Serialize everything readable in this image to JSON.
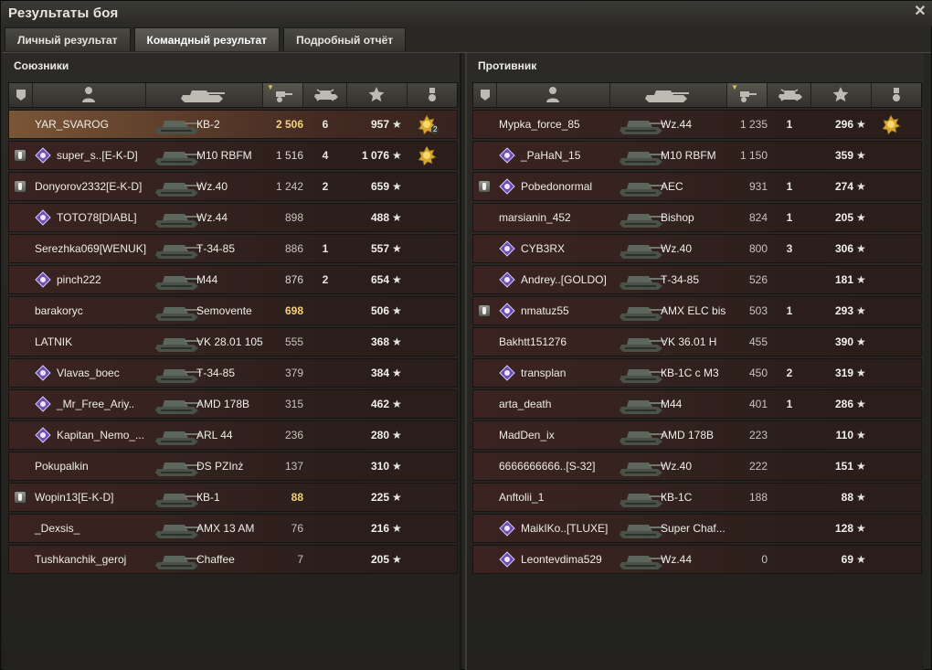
{
  "window": {
    "title": "Результаты боя"
  },
  "tabs": [
    {
      "label": "Личный результат",
      "active": false
    },
    {
      "label": "Командный результат",
      "active": true
    },
    {
      "label": "Подробный отчёт",
      "active": false
    }
  ],
  "colors": {
    "damage_highlight": "#f3d27a",
    "self_row": "#7a5637",
    "row_bg": "#3a2320"
  },
  "teams": [
    {
      "title": "Союзники",
      "rows": [
        {
          "name": "YAR_SVAROG",
          "tank": "КВ-2",
          "damage": "2 506",
          "kills": "6",
          "xp": "957",
          "platoon": false,
          "clan": false,
          "medal": true,
          "medal_count": "2",
          "self": true,
          "dmg_class": "hi"
        },
        {
          "name": "super_s..[E-K-D]",
          "tank": "M10 RBFM",
          "damage": "1 516",
          "kills": "4",
          "xp": "1 076",
          "platoon": true,
          "clan": true,
          "medal": true,
          "medal_count": "",
          "self": false,
          "dmg_class": "mid"
        },
        {
          "name": "Donyorov2332[E-K-D]",
          "tank": "Wz.40",
          "damage": "1 242",
          "kills": "2",
          "xp": "659",
          "platoon": true,
          "clan": false,
          "medal": false,
          "medal_count": "",
          "self": false,
          "dmg_class": ""
        },
        {
          "name": "TOTO78[DIABL]",
          "tank": "Wz.44",
          "damage": "898",
          "kills": "",
          "xp": "488",
          "platoon": false,
          "clan": true,
          "medal": false,
          "medal_count": "",
          "self": false,
          "dmg_class": ""
        },
        {
          "name": "Serezhka069[WENUK]",
          "tank": "Т-34-85",
          "damage": "886",
          "kills": "1",
          "xp": "557",
          "platoon": false,
          "clan": false,
          "medal": false,
          "medal_count": "",
          "self": false,
          "dmg_class": ""
        },
        {
          "name": "pinch222",
          "tank": "M44",
          "damage": "876",
          "kills": "2",
          "xp": "654",
          "platoon": false,
          "clan": true,
          "medal": false,
          "medal_count": "",
          "self": false,
          "dmg_class": "mid"
        },
        {
          "name": "barakoryc",
          "tank": "Semovente",
          "damage": "698",
          "kills": "",
          "xp": "506",
          "platoon": false,
          "clan": false,
          "medal": false,
          "medal_count": "",
          "self": false,
          "dmg_class": "hi"
        },
        {
          "name": "LATNIK",
          "tank": "VK 28.01 105",
          "damage": "555",
          "kills": "",
          "xp": "368",
          "platoon": false,
          "clan": false,
          "medal": false,
          "medal_count": "",
          "self": false,
          "dmg_class": ""
        },
        {
          "name": "Vlavas_boec",
          "tank": "Т-34-85",
          "damage": "379",
          "kills": "",
          "xp": "384",
          "platoon": false,
          "clan": true,
          "medal": false,
          "medal_count": "",
          "self": false,
          "dmg_class": ""
        },
        {
          "name": "_Mr_Free_Ariy..",
          "tank": "AMD 178B",
          "damage": "315",
          "kills": "",
          "xp": "462",
          "platoon": false,
          "clan": true,
          "medal": false,
          "medal_count": "",
          "self": false,
          "dmg_class": ""
        },
        {
          "name": "Kapitan_Nemo_...",
          "tank": "ARL 44",
          "damage": "236",
          "kills": "",
          "xp": "280",
          "platoon": false,
          "clan": true,
          "medal": false,
          "medal_count": "",
          "self": false,
          "dmg_class": ""
        },
        {
          "name": "Pokupalkin",
          "tank": "DS PZInż",
          "damage": "137",
          "kills": "",
          "xp": "310",
          "platoon": false,
          "clan": false,
          "medal": false,
          "medal_count": "",
          "self": false,
          "dmg_class": ""
        },
        {
          "name": "Wopin13[E-K-D]",
          "tank": "КВ-1",
          "damage": "88",
          "kills": "",
          "xp": "225",
          "platoon": true,
          "clan": false,
          "medal": false,
          "medal_count": "",
          "self": false,
          "dmg_class": "hi"
        },
        {
          "name": "_Dexsis_",
          "tank": "AMX 13 AM",
          "damage": "76",
          "kills": "",
          "xp": "216",
          "platoon": false,
          "clan": false,
          "medal": false,
          "medal_count": "",
          "self": false,
          "dmg_class": ""
        },
        {
          "name": "Tushkanchik_geroj",
          "tank": "Chaffee",
          "damage": "7",
          "kills": "",
          "xp": "205",
          "platoon": false,
          "clan": false,
          "medal": false,
          "medal_count": "",
          "self": false,
          "dmg_class": ""
        }
      ]
    },
    {
      "title": "Противник",
      "rows": [
        {
          "name": "Mypka_force_85",
          "tank": "Wz.44",
          "damage": "1 235",
          "kills": "1",
          "xp": "296",
          "platoon": false,
          "clan": false,
          "medal": true,
          "medal_count": "",
          "self": false,
          "dmg_class": ""
        },
        {
          "name": "_PaHaN_15",
          "tank": "M10 RBFM",
          "damage": "1 150",
          "kills": "",
          "xp": "359",
          "platoon": false,
          "clan": true,
          "medal": false,
          "medal_count": "",
          "self": false,
          "dmg_class": ""
        },
        {
          "name": "Pobedonormal",
          "tank": "AEC",
          "damage": "931",
          "kills": "1",
          "xp": "274",
          "platoon": true,
          "clan": true,
          "medal": false,
          "medal_count": "",
          "self": false,
          "dmg_class": ""
        },
        {
          "name": "marsianin_452",
          "tank": "Bishop",
          "damage": "824",
          "kills": "1",
          "xp": "205",
          "platoon": false,
          "clan": false,
          "medal": false,
          "medal_count": "",
          "self": false,
          "dmg_class": ""
        },
        {
          "name": "CYB3RX",
          "tank": "Wz.40",
          "damage": "800",
          "kills": "3",
          "xp": "306",
          "platoon": false,
          "clan": true,
          "medal": false,
          "medal_count": "",
          "self": false,
          "dmg_class": ""
        },
        {
          "name": "Andrey..[GOLDO]",
          "tank": "Т-34-85",
          "damage": "526",
          "kills": "",
          "xp": "181",
          "platoon": false,
          "clan": true,
          "medal": false,
          "medal_count": "",
          "self": false,
          "dmg_class": ""
        },
        {
          "name": "nmatuz55",
          "tank": "AMX ELC bis",
          "damage": "503",
          "kills": "1",
          "xp": "293",
          "platoon": true,
          "clan": true,
          "medal": false,
          "medal_count": "",
          "self": false,
          "dmg_class": ""
        },
        {
          "name": "Bakhtt151276",
          "tank": "VK 36.01 H",
          "damage": "455",
          "kills": "",
          "xp": "390",
          "platoon": false,
          "clan": false,
          "medal": false,
          "medal_count": "",
          "self": false,
          "dmg_class": ""
        },
        {
          "name": "transplan",
          "tank": "КВ-1С с М3",
          "damage": "450",
          "kills": "2",
          "xp": "319",
          "platoon": false,
          "clan": true,
          "medal": false,
          "medal_count": "",
          "self": false,
          "dmg_class": ""
        },
        {
          "name": "arta_death",
          "tank": "M44",
          "damage": "401",
          "kills": "1",
          "xp": "286",
          "platoon": false,
          "clan": false,
          "medal": false,
          "medal_count": "",
          "self": false,
          "dmg_class": ""
        },
        {
          "name": "MadDen_ix",
          "tank": "AMD 178B",
          "damage": "223",
          "kills": "",
          "xp": "110",
          "platoon": false,
          "clan": false,
          "medal": false,
          "medal_count": "",
          "self": false,
          "dmg_class": ""
        },
        {
          "name": "6666666666..[S-32]",
          "tank": "Wz.40",
          "damage": "222",
          "kills": "",
          "xp": "151",
          "platoon": false,
          "clan": false,
          "medal": false,
          "medal_count": "",
          "self": false,
          "dmg_class": ""
        },
        {
          "name": "Anftolii_1",
          "tank": "КВ-1С",
          "damage": "188",
          "kills": "",
          "xp": "88",
          "platoon": false,
          "clan": false,
          "medal": false,
          "medal_count": "",
          "self": false,
          "dmg_class": ""
        },
        {
          "name": "MaikIKo..[TLUXE]",
          "tank": "Super Chaf...",
          "damage": "",
          "kills": "",
          "xp": "128",
          "platoon": false,
          "clan": true,
          "medal": false,
          "medal_count": "",
          "self": false,
          "dmg_class": ""
        },
        {
          "name": "Leontevdima529",
          "tank": "Wz.44",
          "damage": "0",
          "kills": "",
          "xp": "69",
          "platoon": false,
          "clan": true,
          "medal": false,
          "medal_count": "",
          "self": false,
          "dmg_class": ""
        }
      ]
    }
  ],
  "icons": {
    "star": "★",
    "close": "✕"
  }
}
